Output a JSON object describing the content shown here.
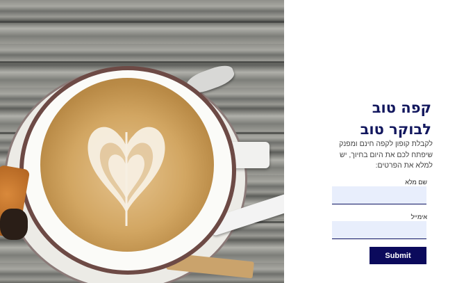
{
  "hero_image": {
    "description_icon": "coffee-latte-photo"
  },
  "form": {
    "title": "קפה טוב לבוקר טוב",
    "description": "לקבלת קופון לקפה חינם ומפנק שיפתח לכם את היום בחיוך, יש למלא את הפרטים:",
    "fields": [
      {
        "label": "שם מלא",
        "value": "",
        "placeholder": ""
      },
      {
        "label": "אימייל",
        "value": "",
        "placeholder": ""
      }
    ],
    "submit_label": "Submit"
  },
  "colors": {
    "title": "#12175e",
    "submit_bg": "#0b0a5c",
    "field_bg": "#e8eefc"
  }
}
